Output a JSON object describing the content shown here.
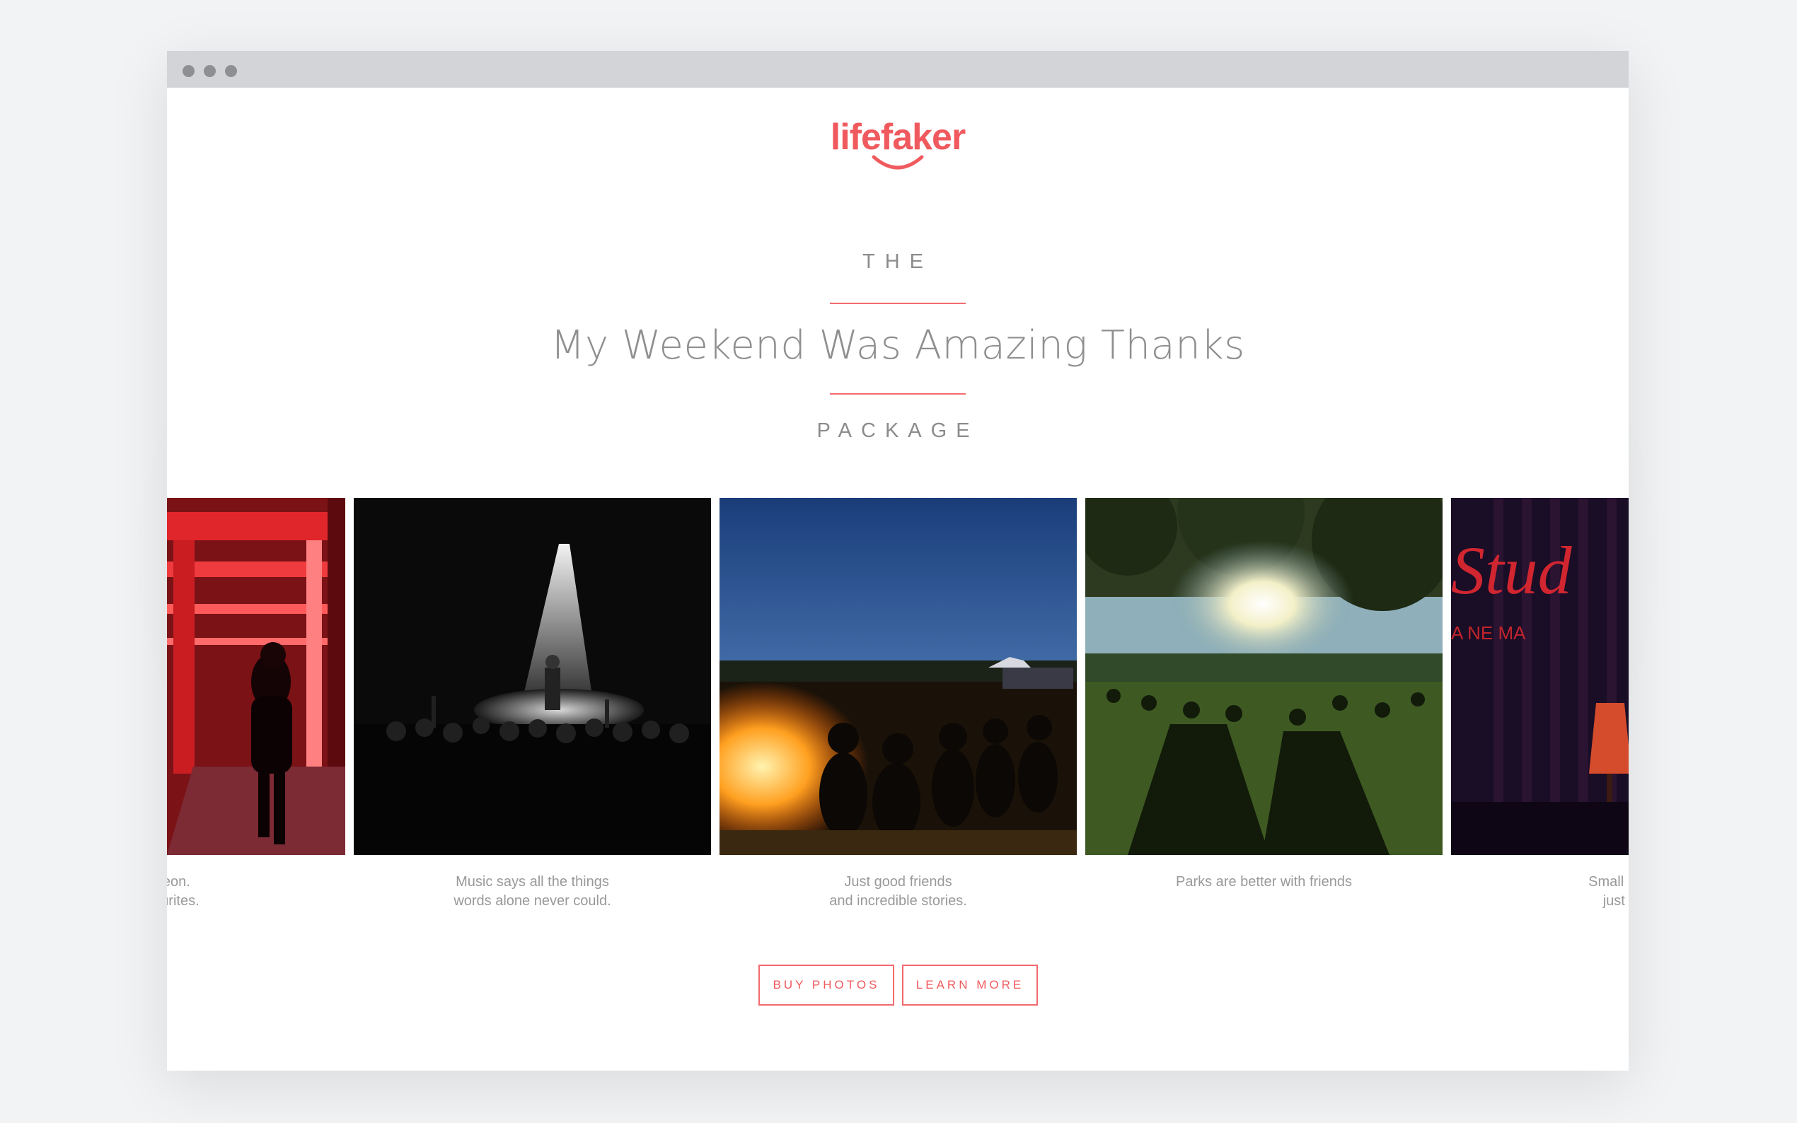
{
  "brand": {
    "name": "lifefaker",
    "accent": "#f05a5e"
  },
  "hero": {
    "pretitle": "THE",
    "title": "My Weekend Was Amazing Thanks",
    "posttitle": "PACKAGE"
  },
  "gallery": [
    {
      "caption_line1": "d neon.",
      "caption_line2": "favourites."
    },
    {
      "caption_line1": "Music says all the things",
      "caption_line2": "words alone never could."
    },
    {
      "caption_line1": "Just good friends",
      "caption_line2": "and incredible stories."
    },
    {
      "caption_line1": "Parks are better with friends",
      "caption_line2": ""
    },
    {
      "caption_line1": "Small premie",
      "caption_line2": "just frien"
    }
  ],
  "actions": {
    "buy": "BUY PHOTOS",
    "learn": "LEARN MORE"
  },
  "colors": {
    "window_bar": "#d3d4d7",
    "text_gray": "#8f8f8f",
    "accent": "#f05a5e"
  }
}
